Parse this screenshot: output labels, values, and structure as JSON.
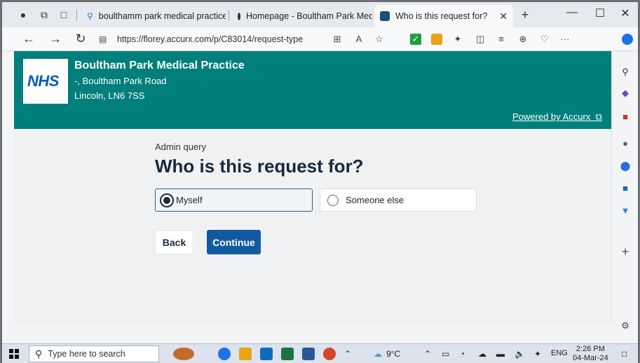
{
  "browser": {
    "tabs": [
      {
        "title": "boulthamm park medical practice"
      },
      {
        "title": "Homepage - Boultham Park Med"
      },
      {
        "title": "Who is this request for?"
      }
    ],
    "url": "https://florey.accurx.com/p/C83014/request-type"
  },
  "header": {
    "logo": "NHS",
    "practice_name": "Boultham Park Medical Practice",
    "address_line1": "-, Boultham Park Road",
    "address_line2": "Lincoln, LN6 7SS",
    "powered_by": "Powered by Accurx"
  },
  "main": {
    "breadcrumb": "Admin query",
    "title": "Who is this request for?",
    "options": [
      {
        "label": "Myself",
        "selected": true
      },
      {
        "label": "Someone else",
        "selected": false
      }
    ],
    "back_label": "Back",
    "continue_label": "Continue"
  },
  "taskbar": {
    "search_placeholder": "Type here to search",
    "weather": "9°C",
    "language": "ENG",
    "time": "2:26 PM",
    "date": "04-Mar-24"
  },
  "colors": {
    "header_bg": "#007f7b",
    "nhs_blue": "#005eb8",
    "primary_button": "#125aa0"
  }
}
